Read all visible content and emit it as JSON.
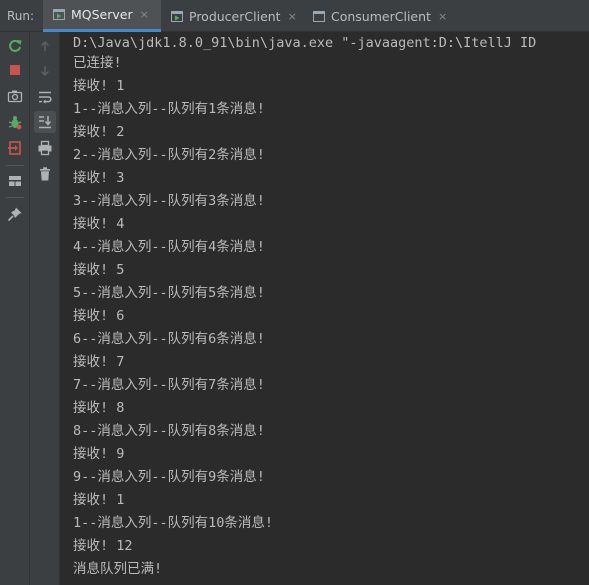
{
  "run_label": "Run:",
  "tabs": [
    {
      "label": "MQServer",
      "active": true,
      "close": "×"
    },
    {
      "label": "ProducerClient",
      "active": false,
      "close": "×"
    },
    {
      "label": "ConsumerClient",
      "active": false,
      "close": "×"
    }
  ],
  "toolbar": {
    "rerun": "rerun-icon",
    "stop": "stop-icon",
    "camera": "camera-icon",
    "debug": "bug-icon",
    "exit": "exit-icon",
    "layout": "layout-icon",
    "pin": "pin-icon",
    "up": "arrow-up-icon",
    "down": "arrow-down-icon",
    "wrap": "soft-wrap-icon",
    "scroll_end": "scroll-to-end-icon",
    "print": "print-icon",
    "trash": "trash-icon"
  },
  "console": {
    "lines": [
      "D:\\Java\\jdk1.8.0_91\\bin\\java.exe \"-javaagent:D:\\ItellJ ID",
      "已连接!",
      "接收! 1",
      "1--消息入列--队列有1条消息!",
      "接收! 2",
      "2--消息入列--队列有2条消息!",
      "接收! 3",
      "3--消息入列--队列有3条消息!",
      "接收! 4",
      "4--消息入列--队列有4条消息!",
      "接收! 5",
      "5--消息入列--队列有5条消息!",
      "接收! 6",
      "6--消息入列--队列有6条消息!",
      "接收! 7",
      "7--消息入列--队列有7条消息!",
      "接收! 8",
      "8--消息入列--队列有8条消息!",
      "接收! 9",
      "9--消息入列--队列有9条消息!",
      "接收! 1",
      "1--消息入列--队列有10条消息!",
      "接收! 12",
      "消息队列已满!"
    ]
  },
  "colors": {
    "background": "#2b2b2b",
    "panel": "#3c3f41",
    "active_tab": "#4e5254",
    "accent": "#4a88c7",
    "text": "#bbbbbb",
    "rerun_green": "#59a869",
    "stop_red": "#c75450"
  }
}
